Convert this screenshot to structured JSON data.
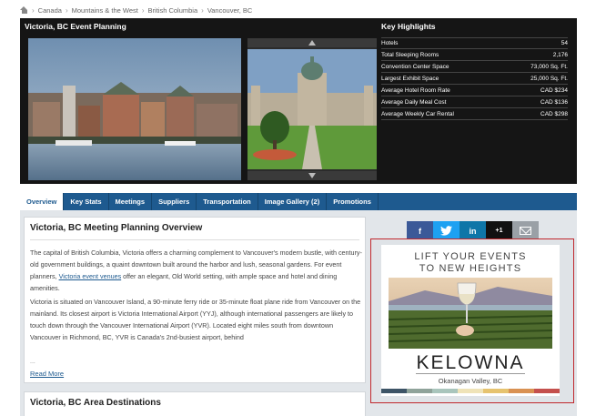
{
  "breadcrumb": [
    "Canada",
    "Mountains & the West",
    "British Columbia",
    "Vancouver, BC"
  ],
  "hero": {
    "title": "Victoria, BC Event Planning"
  },
  "key_highlights": {
    "title": "Key Highlights",
    "rows": [
      {
        "label": "Hotels",
        "value": "54"
      },
      {
        "label": "Total Sleeping Rooms",
        "value": "2,176"
      },
      {
        "label": "Convention Center Space",
        "value": "73,000 Sq. Ft."
      },
      {
        "label": "Largest Exhibit Space",
        "value": "25,000 Sq. Ft."
      },
      {
        "label": "Average Hotel Room Rate",
        "value": "CAD $234"
      },
      {
        "label": "Average Daily Meal Cost",
        "value": "CAD $136"
      },
      {
        "label": "Average Weekly Car Rental",
        "value": "CAD $298"
      }
    ]
  },
  "tabs": [
    "Overview",
    "Key Stats",
    "Meetings",
    "Suppliers",
    "Transportation",
    "Image Gallery (2)",
    "Promotions"
  ],
  "overview": {
    "title": "Victoria, BC Meeting Planning Overview",
    "p1_before": "The capital of British Columbia, Victoria offers a charming complement to Vancouver's modern bustle, with century-old government buildings, a quaint downtown built around the harbor and lush, seasonal gardens. For event planners, ",
    "p1_link": "Victoria event venues",
    "p1_after": " offer an elegant, Old World setting, with ample space and hotel and dining amenities.",
    "p2": "Victoria is situated on Vancouver Island, a 90-minute ferry ride or 35-minute float plane ride from Vancouver on the mainland. Its closest airport is Victoria International Airport (YYJ), although international passengers are likely to touch down through the Vancouver International Airport (YVR). Located eight miles south from downtown Vancouver in Richmond, BC, YVR is Canada's 2nd-busiest airport, behind",
    "ellipsis": "...",
    "read_more": "Read More"
  },
  "destinations": {
    "title": "Victoria, BC Area Destinations"
  },
  "social": {
    "facebook": "f",
    "twitter": "t",
    "linkedin": "in",
    "gplus": "+1"
  },
  "ad": {
    "headline1": "LIFT YOUR EVENTS",
    "headline2": "TO NEW HEIGHTS",
    "brand": "KELOWNA",
    "tagline": "Okanagan Valley, BC",
    "stripe_colors": [
      "#3d5466",
      "#8fa39a",
      "#a9c5bc",
      "#efe3b8",
      "#e6c36f",
      "#d99152",
      "#c4504d"
    ]
  },
  "colors": {
    "tab_bar": "#1e5a8f",
    "ad_border": "#c0272d",
    "hero_bg": "#151515"
  }
}
